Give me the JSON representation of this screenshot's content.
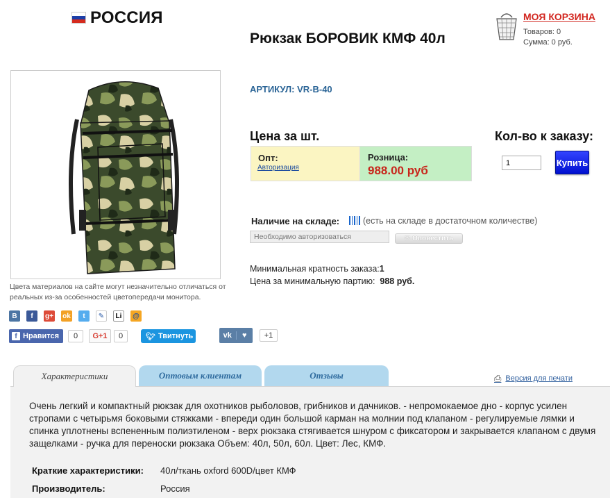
{
  "header": {
    "country": "РОССИЯ",
    "cart_title": "МОЯ КОРЗИНА",
    "cart_items": "Товаров: 0",
    "cart_sum": "Сумма: 0 руб."
  },
  "product": {
    "title": "Рюкзак БОРОВИК КМФ 40л",
    "article": "АРТИКУЛ: VR-B-40",
    "disclaimer": "Цвета материалов на сайте могут незначительно отличаться от реальных из-за особенностей цветопередачи монитора."
  },
  "pricing": {
    "price_head": "Цена за шт.",
    "qty_head": "Кол-во к заказу:",
    "opt_label": "Опт:",
    "opt_link": "Авторизация",
    "retail_label": "Розница:",
    "retail_price": "988.00 руб",
    "qty_value": "1",
    "buy_label": "Купить"
  },
  "stock": {
    "label": "Наличие на складе:",
    "text": "(есть на складе в достаточном количестве)",
    "auth_placeholder": "Необходимо авторизоваться",
    "notify_label": "Оповестить"
  },
  "minimum": {
    "multiplicity_label": "Минимальная кратность заказа:",
    "multiplicity_value": "1",
    "batch_label": "Цена за минимальную партию:",
    "batch_value": "988 руб."
  },
  "social": {
    "fb_label": "Нравится",
    "fb_count": "0",
    "gplus_label": "G+1",
    "gplus_count": "0",
    "tw_label": "Твитнуть",
    "vk_count": "+1",
    "icons": [
      "vk-icon",
      "facebook-icon",
      "google-plus-icon",
      "odnoklassniki-icon",
      "twitter-icon",
      "livejournal-icon",
      "liveinternet-icon",
      "mailru-icon"
    ]
  },
  "tabs": [
    {
      "label": "Характеристики"
    },
    {
      "label": "Оптовым клиентам"
    },
    {
      "label": "Отзывы"
    }
  ],
  "print_label": "Версия для печати",
  "description": "Очень легкий и компактный рюкзак для охотников рыболовов, грибников и дачников. - непромокаемое дно - корпус усилен стропами с четырьмя боковыми стяжками - впереди один большой карман на молнии под клапаном - регулируемые лямки и спинка уплотнены вспененным полиэтиленом - верх рюкзака стягивается шнуром с фиксатором и закрывается клапаном с двумя защелками - ручка для переноски рюкзака Объем: 40л, 50л, 60л. Цвет: Лес, КМФ.",
  "specs": [
    {
      "label": "Краткие характеристики:",
      "value": "40л/ткань oxford 600D/цвет КМФ"
    },
    {
      "label": "Производитель:",
      "value": "Россия"
    }
  ],
  "colors": {
    "accent_red": "#c8261c",
    "link_blue": "#2a6496",
    "buy_blue": "#0010d0",
    "opt_bg": "#fbf5c2",
    "retail_bg": "#c4efc4",
    "tab_blue": "#b2d8ee"
  }
}
